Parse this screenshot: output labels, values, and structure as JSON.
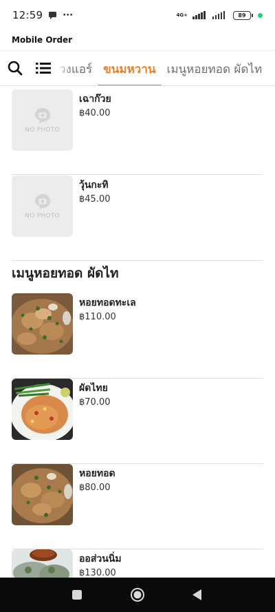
{
  "status_bar": {
    "time": "12:59",
    "more": "···",
    "network": "4G+",
    "battery": "89"
  },
  "app": {
    "title": "Mobile Order"
  },
  "tabs": [
    {
      "label": "วงแอร์"
    },
    {
      "label": "ขนมหวาน",
      "active": true
    },
    {
      "label": "เมนูหอยทอด ผัดไท"
    }
  ],
  "placeholder_text": "NO PHOTO",
  "dessert_items": [
    {
      "name": "เฉาก๊วย",
      "price": "฿40.00"
    },
    {
      "name": "วุ้นกะทิ",
      "price": "฿45.00"
    }
  ],
  "section": {
    "title": "เมนูหอยทอด ผัดไท"
  },
  "menu_items": [
    {
      "name": "หอยทอดทะเล",
      "price": "฿110.00"
    },
    {
      "name": "ผัดไทย",
      "price": "฿70.00"
    },
    {
      "name": "หอยทอด",
      "price": "฿80.00"
    },
    {
      "name": "ออส่วนนิ่ม",
      "price": "฿130.00"
    }
  ],
  "colors": {
    "accent": "#ef7d22",
    "nav_bar": "#0a0a0a",
    "placeholder_bg": "#ececec"
  },
  "icons": {
    "search": "search-icon",
    "menu": "list-menu-icon",
    "chat": "chat-bubble-icon",
    "placeholder": "camera-icon",
    "nav_recents": "square-icon",
    "nav_home": "circle-icon",
    "nav_back": "triangle-back-icon"
  }
}
